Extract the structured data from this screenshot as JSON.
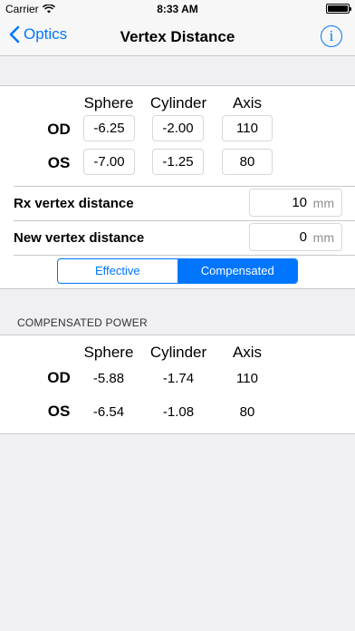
{
  "status_bar": {
    "carrier": "Carrier",
    "time": "8:33 AM"
  },
  "nav": {
    "back_label": "Optics",
    "title": "Vertex Distance",
    "info_glyph": "i"
  },
  "prescription": {
    "columns": [
      "Sphere",
      "Cylinder",
      "Axis"
    ],
    "rows": [
      {
        "label": "OD",
        "sphere": "-6.25",
        "cylinder": "-2.00",
        "axis": "110"
      },
      {
        "label": "OS",
        "sphere": "-7.00",
        "cylinder": "-1.25",
        "axis": "80"
      }
    ]
  },
  "rx_vertex": {
    "label": "Rx vertex distance",
    "value": "10",
    "unit": "mm"
  },
  "new_vertex": {
    "label": "New vertex distance",
    "value": "0",
    "unit": "mm"
  },
  "mode": {
    "options": [
      "Effective",
      "Compensated"
    ],
    "selected": "Compensated"
  },
  "result": {
    "header": "COMPENSATED POWER",
    "columns": [
      "Sphere",
      "Cylinder",
      "Axis"
    ],
    "rows": [
      {
        "label": "OD",
        "sphere": "-5.88",
        "cylinder": "-1.74",
        "axis": "110"
      },
      {
        "label": "OS",
        "sphere": "-6.54",
        "cylinder": "-1.08",
        "axis": "80"
      }
    ]
  },
  "colors": {
    "accent": "#0076ff",
    "background": "#efeff4"
  },
  "icons": {
    "back": "chevron-left-icon",
    "info": "info-circle-icon",
    "wifi": "wifi-icon",
    "battery": "battery-icon"
  }
}
